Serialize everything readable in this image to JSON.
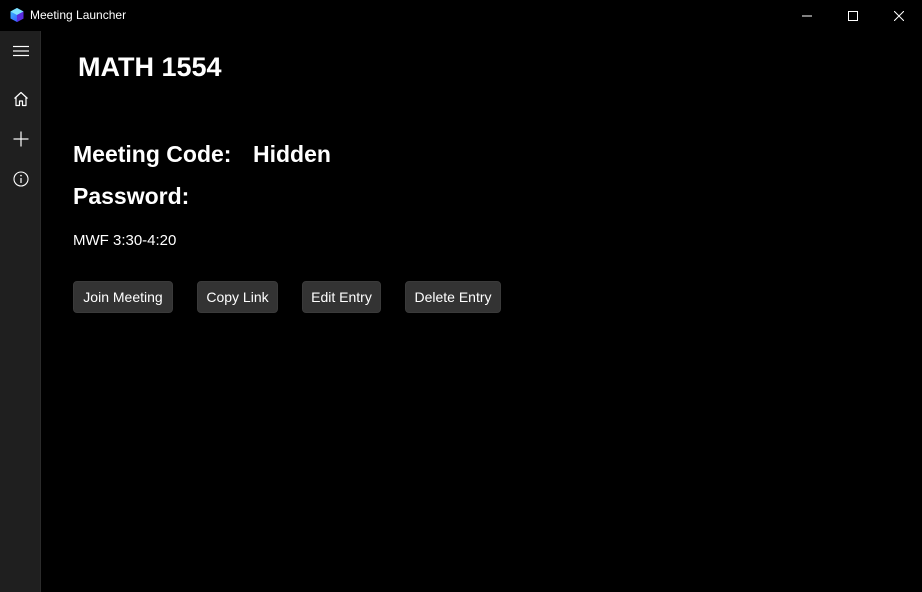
{
  "window": {
    "title": "Meeting Launcher",
    "icon": "app-logo-icon",
    "caption_buttons": [
      "minimize-icon",
      "maximize-icon",
      "close-icon"
    ]
  },
  "nav": {
    "items": [
      {
        "icon": "hamburger-menu-icon"
      },
      {
        "icon": "home-icon"
      },
      {
        "icon": "add-icon"
      },
      {
        "icon": "info-icon"
      }
    ]
  },
  "meeting": {
    "title": "MATH 1554",
    "code_label": "Meeting Code:",
    "code_value": "Hidden",
    "password_label": "Password:",
    "password_value": "",
    "schedule": "MWF 3:30-4:20"
  },
  "actions": {
    "join_label": "Join Meeting",
    "copy_label": "Copy Link",
    "edit_label": "Edit Entry",
    "delete_label": "Delete Entry"
  },
  "colors": {
    "background": "#000000",
    "nav_background": "#1f1f1f",
    "button_background": "#333333",
    "text": "#ffffff"
  }
}
